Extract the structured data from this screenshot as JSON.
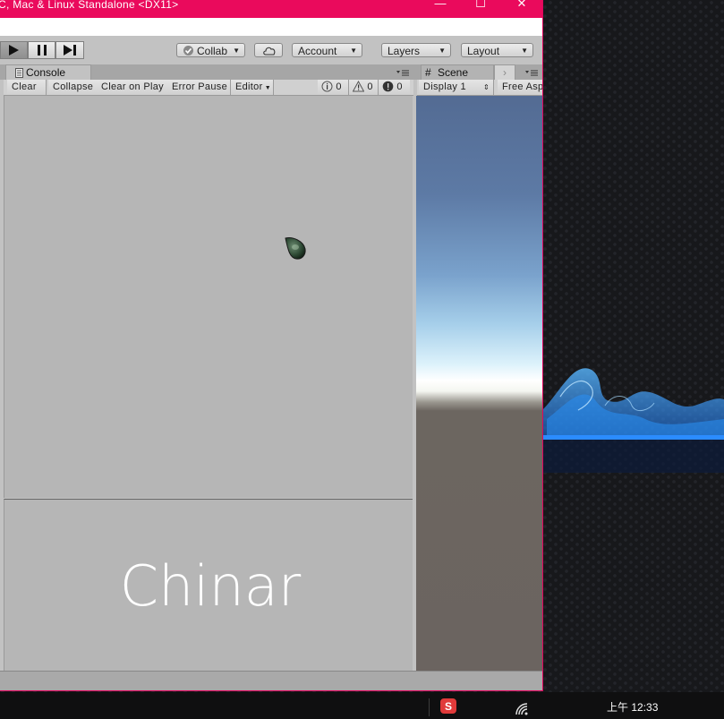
{
  "window": {
    "title": "C, Mac & Linux Standalone <DX11>",
    "minimize_glyph": "—",
    "maximize_glyph": "☐",
    "close_glyph": "✕",
    "accent": "#ea0a5c"
  },
  "toolbar": {
    "collab_label": "Collab",
    "account_label": "Account",
    "layers_label": "Layers",
    "layout_label": "Layout"
  },
  "console": {
    "tab_label": "Console",
    "clear_label": "Clear",
    "collapse_label": "Collapse",
    "clear_on_play_label": "Clear on Play",
    "error_pause_label": "Error Pause",
    "editor_label": "Editor",
    "info_count": "0",
    "warning_count": "0",
    "error_count": "0"
  },
  "scene": {
    "tab_label": "Scene",
    "display_label": "Display 1",
    "aspect_label": "Free Asp"
  },
  "watermark": "Chinar",
  "taskbar": {
    "clock": "上午 12:33"
  }
}
